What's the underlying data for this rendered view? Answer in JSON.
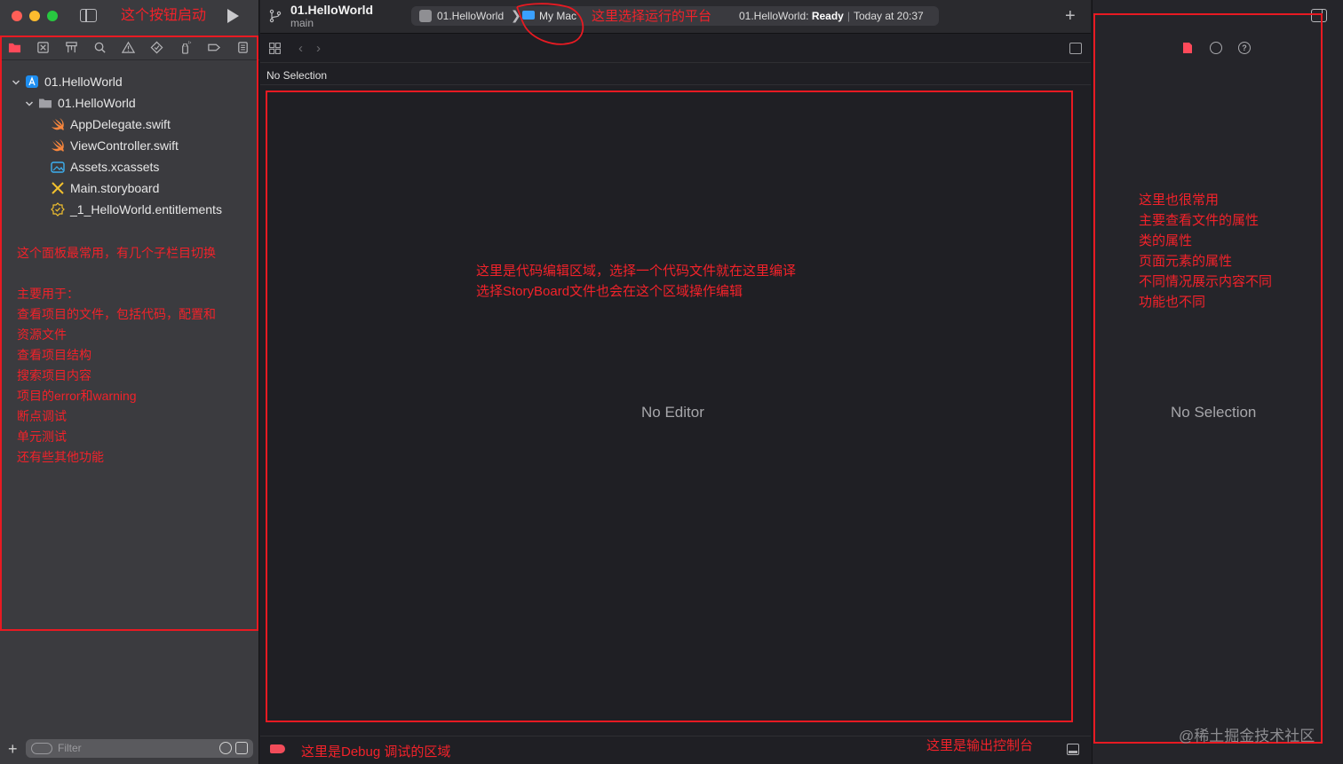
{
  "toolbar": {
    "project_title": "01.HelloWorld",
    "branch": "main",
    "scheme": "01.HelloWorld",
    "scheme_separator": "❯",
    "destination": "My Mac",
    "status_label": "01.HelloWorld:",
    "status_state": "Ready",
    "status_separator": "|",
    "status_time": "Today at 20:37",
    "add_label": "+"
  },
  "editor": {
    "jump_bar_text": "No Selection",
    "empty_text": "No Editor",
    "back": "‹",
    "forward": "›"
  },
  "inspector": {
    "empty_text": "No Selection",
    "help_label": "?"
  },
  "navigator": {
    "items": [
      {
        "label": "01.HelloWorld",
        "icon": "xcode-project-icon",
        "level": 0,
        "expanded": true
      },
      {
        "label": "01.HelloWorld",
        "icon": "folder-icon",
        "level": 1,
        "expanded": true
      },
      {
        "label": "AppDelegate.swift",
        "icon": "swift-file-icon",
        "level": 2
      },
      {
        "label": "ViewController.swift",
        "icon": "swift-file-icon",
        "level": 2
      },
      {
        "label": "Assets.xcassets",
        "icon": "asset-catalog-icon",
        "level": 2
      },
      {
        "label": "Main.storyboard",
        "icon": "storyboard-icon",
        "level": 2
      },
      {
        "label": "_1_HelloWorld.entitlements",
        "icon": "entitlements-icon",
        "level": 2
      }
    ],
    "add_label": "+",
    "filter_placeholder": "Filter"
  },
  "annotations": {
    "run_note": "这个按钮启动",
    "platform_note": "这里选择运行的平台",
    "navigator_lines": [
      "这个面板最常用，有几个子栏目切换",
      "",
      "主要用于：",
      "查看项目的文件，包括代码，配置和",
      "资源文件",
      "查看项目结构",
      "搜索项目内容",
      "项目的error和warning",
      "断点调试",
      "单元测试",
      "还有些其他功能"
    ],
    "editor_lines": [
      "这里是代码编辑区域，选择一个代码文件就在这里编译",
      "选择StoryBoard文件也会在这个区域操作编辑"
    ],
    "inspector_lines": [
      "这里也很常用",
      "主要查看文件的属性",
      "类的属性",
      "页面元素的属性",
      "不同情况展示内容不同",
      "功能也不同"
    ],
    "debug_note": "这里是Debug 调试的区域",
    "console_note": "这里是输出控制台"
  },
  "watermark": "@稀土掘金技术社区",
  "colors": {
    "annotation": "#f2222a",
    "breakpoint": "#f24c5a",
    "accent_blue": "#3aa0ff"
  }
}
